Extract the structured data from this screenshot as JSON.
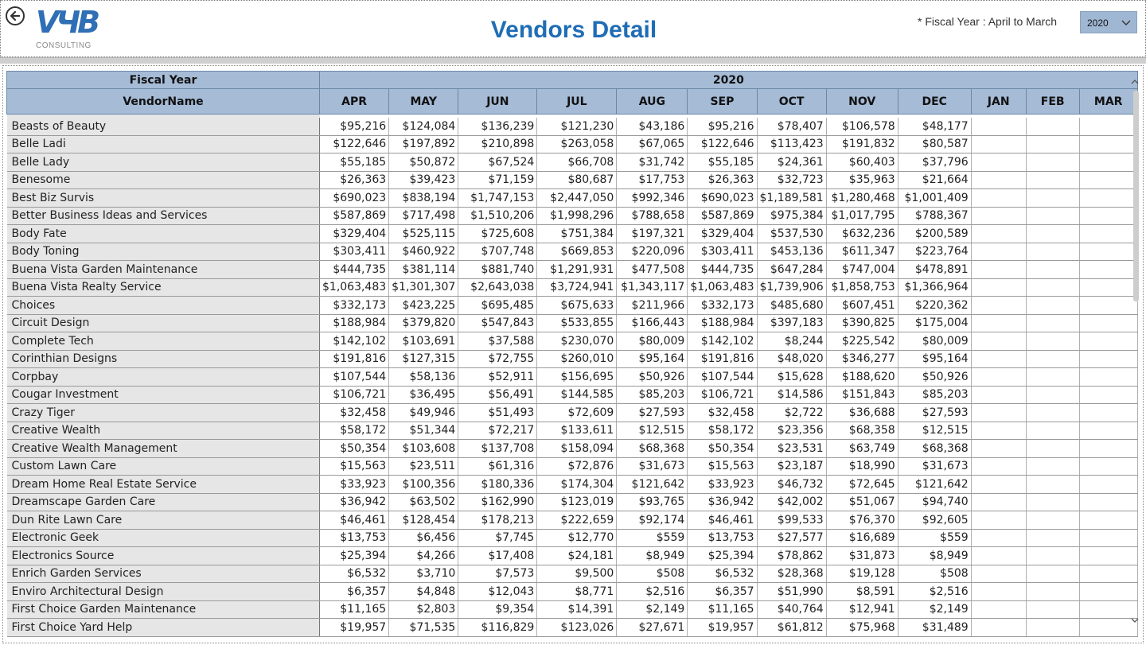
{
  "header": {
    "title": "Vendors Detail",
    "logo_text": "VЧB",
    "logo_sub": "CONSULTING",
    "fiscal_note": "* Fiscal Year : April to March",
    "year_value": "2020",
    "icons": {
      "back": "back-arrow-circle-icon",
      "dropdown": "chevron-down-icon"
    }
  },
  "colors": {
    "title": "#1f6db5",
    "header_bg": "#a5bbd6",
    "vendor_bg": "#e6e6e6"
  },
  "table": {
    "top_left_label": "Fiscal Year",
    "year_label": "2020",
    "row_header": "VendorName",
    "months": [
      "APR",
      "MAY",
      "JUN",
      "JUL",
      "AUG",
      "SEP",
      "OCT",
      "NOV",
      "DEC",
      "JAN",
      "FEB",
      "MAR"
    ],
    "rows": [
      {
        "name": "Beasts of Beauty",
        "values": [
          "$95,216",
          "$124,084",
          "$136,239",
          "$121,230",
          "$43,186",
          "$95,216",
          "$78,407",
          "$106,578",
          "$48,177",
          "",
          "",
          ""
        ]
      },
      {
        "name": "Belle Ladi",
        "values": [
          "$122,646",
          "$197,892",
          "$210,898",
          "$263,058",
          "$67,065",
          "$122,646",
          "$113,423",
          "$191,832",
          "$80,587",
          "",
          "",
          ""
        ]
      },
      {
        "name": "Belle Lady",
        "values": [
          "$55,185",
          "$50,872",
          "$67,524",
          "$66,708",
          "$31,742",
          "$55,185",
          "$24,361",
          "$60,403",
          "$37,796",
          "",
          "",
          ""
        ]
      },
      {
        "name": "Benesome",
        "values": [
          "$26,363",
          "$39,423",
          "$71,159",
          "$80,687",
          "$17,753",
          "$26,363",
          "$32,723",
          "$35,963",
          "$21,664",
          "",
          "",
          ""
        ]
      },
      {
        "name": "Best Biz Survis",
        "values": [
          "$690,023",
          "$838,194",
          "$1,747,153",
          "$2,447,050",
          "$992,346",
          "$690,023",
          "$1,189,581",
          "$1,280,468",
          "$1,001,409",
          "",
          "",
          ""
        ]
      },
      {
        "name": "Better Business Ideas and Services",
        "values": [
          "$587,869",
          "$717,498",
          "$1,510,206",
          "$1,998,296",
          "$788,658",
          "$587,869",
          "$975,384",
          "$1,017,795",
          "$788,367",
          "",
          "",
          ""
        ]
      },
      {
        "name": "Body Fate",
        "values": [
          "$329,404",
          "$525,115",
          "$725,608",
          "$751,384",
          "$197,321",
          "$329,404",
          "$537,530",
          "$632,236",
          "$200,589",
          "",
          "",
          ""
        ]
      },
      {
        "name": "Body Toning",
        "values": [
          "$303,411",
          "$460,922",
          "$707,748",
          "$669,853",
          "$220,096",
          "$303,411",
          "$453,136",
          "$611,347",
          "$223,764",
          "",
          "",
          ""
        ]
      },
      {
        "name": "Buena Vista Garden Maintenance",
        "values": [
          "$444,735",
          "$381,114",
          "$881,740",
          "$1,291,931",
          "$477,508",
          "$444,735",
          "$647,284",
          "$747,004",
          "$478,891",
          "",
          "",
          ""
        ]
      },
      {
        "name": "Buena Vista Realty Service",
        "values": [
          "$1,063,483",
          "$1,301,307",
          "$2,643,038",
          "$3,724,941",
          "$1,343,117",
          "$1,063,483",
          "$1,739,906",
          "$1,858,753",
          "$1,366,964",
          "",
          "",
          ""
        ]
      },
      {
        "name": "Choices",
        "values": [
          "$332,173",
          "$423,225",
          "$695,485",
          "$675,633",
          "$211,966",
          "$332,173",
          "$485,680",
          "$607,451",
          "$220,362",
          "",
          "",
          ""
        ]
      },
      {
        "name": "Circuit Design",
        "values": [
          "$188,984",
          "$379,820",
          "$547,843",
          "$533,855",
          "$166,443",
          "$188,984",
          "$397,183",
          "$390,825",
          "$175,004",
          "",
          "",
          ""
        ]
      },
      {
        "name": "Complete Tech",
        "values": [
          "$142,102",
          "$103,691",
          "$37,588",
          "$230,070",
          "$80,009",
          "$142,102",
          "$8,244",
          "$225,542",
          "$80,009",
          "",
          "",
          ""
        ]
      },
      {
        "name": "Corinthian Designs",
        "values": [
          "$191,816",
          "$127,315",
          "$72,755",
          "$260,010",
          "$95,164",
          "$191,816",
          "$48,020",
          "$346,277",
          "$95,164",
          "",
          "",
          ""
        ]
      },
      {
        "name": "Corpbay",
        "values": [
          "$107,544",
          "$58,136",
          "$52,911",
          "$156,695",
          "$50,926",
          "$107,544",
          "$15,628",
          "$188,620",
          "$50,926",
          "",
          "",
          ""
        ]
      },
      {
        "name": "Cougar Investment",
        "values": [
          "$106,721",
          "$36,495",
          "$56,491",
          "$144,585",
          "$85,203",
          "$106,721",
          "$14,586",
          "$151,843",
          "$85,203",
          "",
          "",
          ""
        ]
      },
      {
        "name": "Crazy Tiger",
        "values": [
          "$32,458",
          "$49,946",
          "$51,493",
          "$72,609",
          "$27,593",
          "$32,458",
          "$2,722",
          "$36,688",
          "$27,593",
          "",
          "",
          ""
        ]
      },
      {
        "name": "Creative Wealth",
        "values": [
          "$58,172",
          "$51,344",
          "$72,217",
          "$133,611",
          "$12,515",
          "$58,172",
          "$23,356",
          "$68,358",
          "$12,515",
          "",
          "",
          ""
        ]
      },
      {
        "name": "Creative Wealth Management",
        "values": [
          "$50,354",
          "$103,608",
          "$137,708",
          "$158,094",
          "$68,368",
          "$50,354",
          "$23,531",
          "$63,749",
          "$68,368",
          "",
          "",
          ""
        ]
      },
      {
        "name": "Custom Lawn Care",
        "values": [
          "$15,563",
          "$23,511",
          "$61,316",
          "$72,876",
          "$31,673",
          "$15,563",
          "$23,187",
          "$18,990",
          "$31,673",
          "",
          "",
          ""
        ]
      },
      {
        "name": "Dream Home Real Estate Service",
        "values": [
          "$33,923",
          "$100,356",
          "$180,336",
          "$174,304",
          "$121,642",
          "$33,923",
          "$46,732",
          "$72,645",
          "$121,642",
          "",
          "",
          ""
        ]
      },
      {
        "name": "Dreamscape Garden Care",
        "values": [
          "$36,942",
          "$63,502",
          "$162,990",
          "$123,019",
          "$93,765",
          "$36,942",
          "$42,002",
          "$51,067",
          "$94,740",
          "",
          "",
          ""
        ]
      },
      {
        "name": "Dun Rite Lawn Care",
        "values": [
          "$46,461",
          "$128,454",
          "$178,213",
          "$222,659",
          "$92,174",
          "$46,461",
          "$99,533",
          "$76,370",
          "$92,605",
          "",
          "",
          ""
        ]
      },
      {
        "name": "Electronic Geek",
        "values": [
          "$13,753",
          "$6,456",
          "$7,745",
          "$12,770",
          "$559",
          "$13,753",
          "$27,577",
          "$16,689",
          "$559",
          "",
          "",
          ""
        ]
      },
      {
        "name": "Electronics Source",
        "values": [
          "$25,394",
          "$4,266",
          "$17,408",
          "$24,181",
          "$8,949",
          "$25,394",
          "$78,862",
          "$31,873",
          "$8,949",
          "",
          "",
          ""
        ]
      },
      {
        "name": "Enrich Garden Services",
        "values": [
          "$6,532",
          "$3,710",
          "$7,573",
          "$9,500",
          "$508",
          "$6,532",
          "$28,368",
          "$19,128",
          "$508",
          "",
          "",
          ""
        ]
      },
      {
        "name": "Enviro Architectural Design",
        "values": [
          "$6,357",
          "$4,848",
          "$12,043",
          "$8,771",
          "$2,516",
          "$6,357",
          "$51,990",
          "$8,591",
          "$2,516",
          "",
          "",
          ""
        ]
      },
      {
        "name": "First Choice Garden Maintenance",
        "values": [
          "$11,165",
          "$2,803",
          "$9,354",
          "$14,391",
          "$2,149",
          "$11,165",
          "$40,764",
          "$12,941",
          "$2,149",
          "",
          "",
          ""
        ]
      },
      {
        "name": "First Choice Yard Help",
        "values": [
          "$19,957",
          "$71,535",
          "$116,829",
          "$123,026",
          "$27,671",
          "$19,957",
          "$61,812",
          "$75,968",
          "$31,489",
          "",
          "",
          ""
        ]
      }
    ]
  },
  "scrollbar": {
    "icons": {
      "up": "scroll-up-arrow-icon",
      "down": "scroll-down-arrow-icon"
    }
  }
}
